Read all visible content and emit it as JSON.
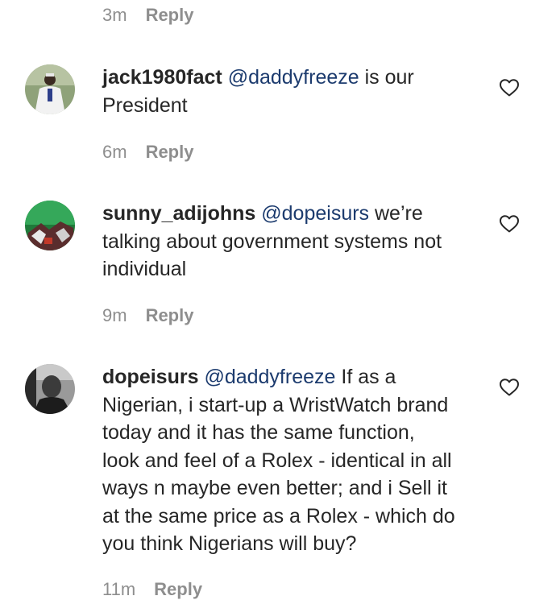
{
  "top_meta": {
    "time": "3m",
    "reply_label": "Reply"
  },
  "comments": [
    {
      "username": "jack1980fact",
      "mention": "@daddyfreeze",
      "lines": [
        " is our",
        "President"
      ],
      "time": "6m",
      "reply_label": "Reply"
    },
    {
      "username": "sunny_adijohns",
      "mention": "@dopeisurs",
      "lines": [
        " we’re",
        "talking about government systems not",
        "individual"
      ],
      "time": "9m",
      "reply_label": "Reply"
    },
    {
      "username": "dopeisurs",
      "mention": "@daddyfreeze",
      "lines": [
        " If as a",
        "Nigerian, i start-up a WristWatch brand",
        "today and it has the same function,",
        "look and feel of a Rolex - identical in all",
        "ways n maybe even better; and i Sell it",
        "at the same price as a Rolex - which do",
        "you think Nigerians will buy?"
      ],
      "time": "11m",
      "reply_label": "Reply"
    }
  ],
  "colors": {
    "text": "#262626",
    "mention": "#1c3b6e",
    "meta": "#8e8e8e",
    "background": "#ffffff"
  },
  "icons": {
    "like": "heart-outline-icon"
  }
}
